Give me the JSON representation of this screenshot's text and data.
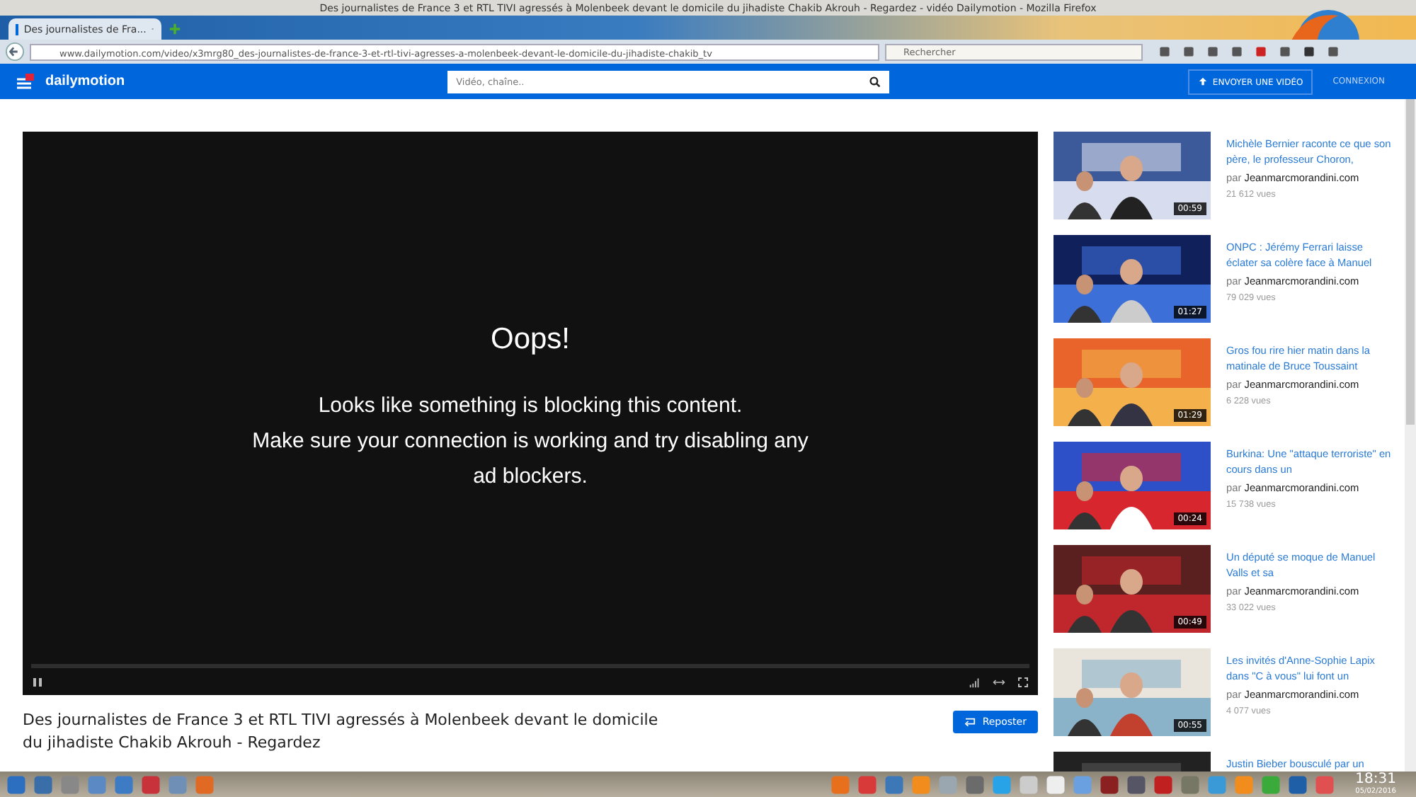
{
  "window": {
    "title": "Des journalistes de France 3 et RTL TIVI agressés à Molenbeek devant le domicile du jihadiste Chakib Akrouh - Regardez - vidéo Dailymotion - Mozilla Firefox"
  },
  "browser": {
    "tab_title": "Des journalistes de Fra...",
    "url": "www.dailymotion.com/video/x3mrg80_des-journalistes-de-france-3-et-rtl-tivi-agresses-a-molenbeek-devant-le-domicile-du-jihadiste-chakib_tv",
    "search_placeholder": "Rechercher"
  },
  "site": {
    "logo": "dailymotion",
    "search_placeholder": "Vidéo, chaîne..",
    "upload": "ENVOYER UNE VIDÉO",
    "login": "CONNEXION"
  },
  "player": {
    "heading": "Oops!",
    "message": "Looks like something is blocking this content.\nMake sure your connection is working and try disabling any\nad blockers."
  },
  "video": {
    "title": "Des journalistes de France 3 et RTL TIVI agressés à Molenbeek devant le domicile du jihadiste Chakib Akrouh - Regardez",
    "repost": "Reposter"
  },
  "related": [
    {
      "title": "Michèle Bernier raconte ce que son père, le professeur Choron,",
      "by": "par",
      "channel": "Jeanmarcmorandini.com",
      "views": "21 612 vues",
      "duration": "00:59"
    },
    {
      "title": "ONPC : Jérémy Ferrari laisse éclater sa colère face à Manuel",
      "by": "par",
      "channel": "Jeanmarcmorandini.com",
      "views": "79 029 vues",
      "duration": "01:27"
    },
    {
      "title": "Gros fou rire hier matin dans la matinale de Bruce Toussaint",
      "by": "par",
      "channel": "Jeanmarcmorandini.com",
      "views": "6 228 vues",
      "duration": "01:29"
    },
    {
      "title": "Burkina: Une \"attaque terroriste\" en cours dans un",
      "by": "par",
      "channel": "Jeanmarcmorandini.com",
      "views": "15 738 vues",
      "duration": "00:24"
    },
    {
      "title": "Un député se moque de Manuel Valls et sa",
      "by": "par",
      "channel": "Jeanmarcmorandini.com",
      "views": "33 022 vues",
      "duration": "00:49"
    },
    {
      "title": "Les invités d'Anne-Sophie Lapix dans \"C à vous\" lui font un",
      "by": "par",
      "channel": "Jeanmarcmorandini.com",
      "views": "4 077 vues",
      "duration": "00:55"
    },
    {
      "title": "Justin Bieber bousculé par un"
    }
  ],
  "taskbar": {
    "time": "18:31",
    "date": "05/02/2016"
  }
}
